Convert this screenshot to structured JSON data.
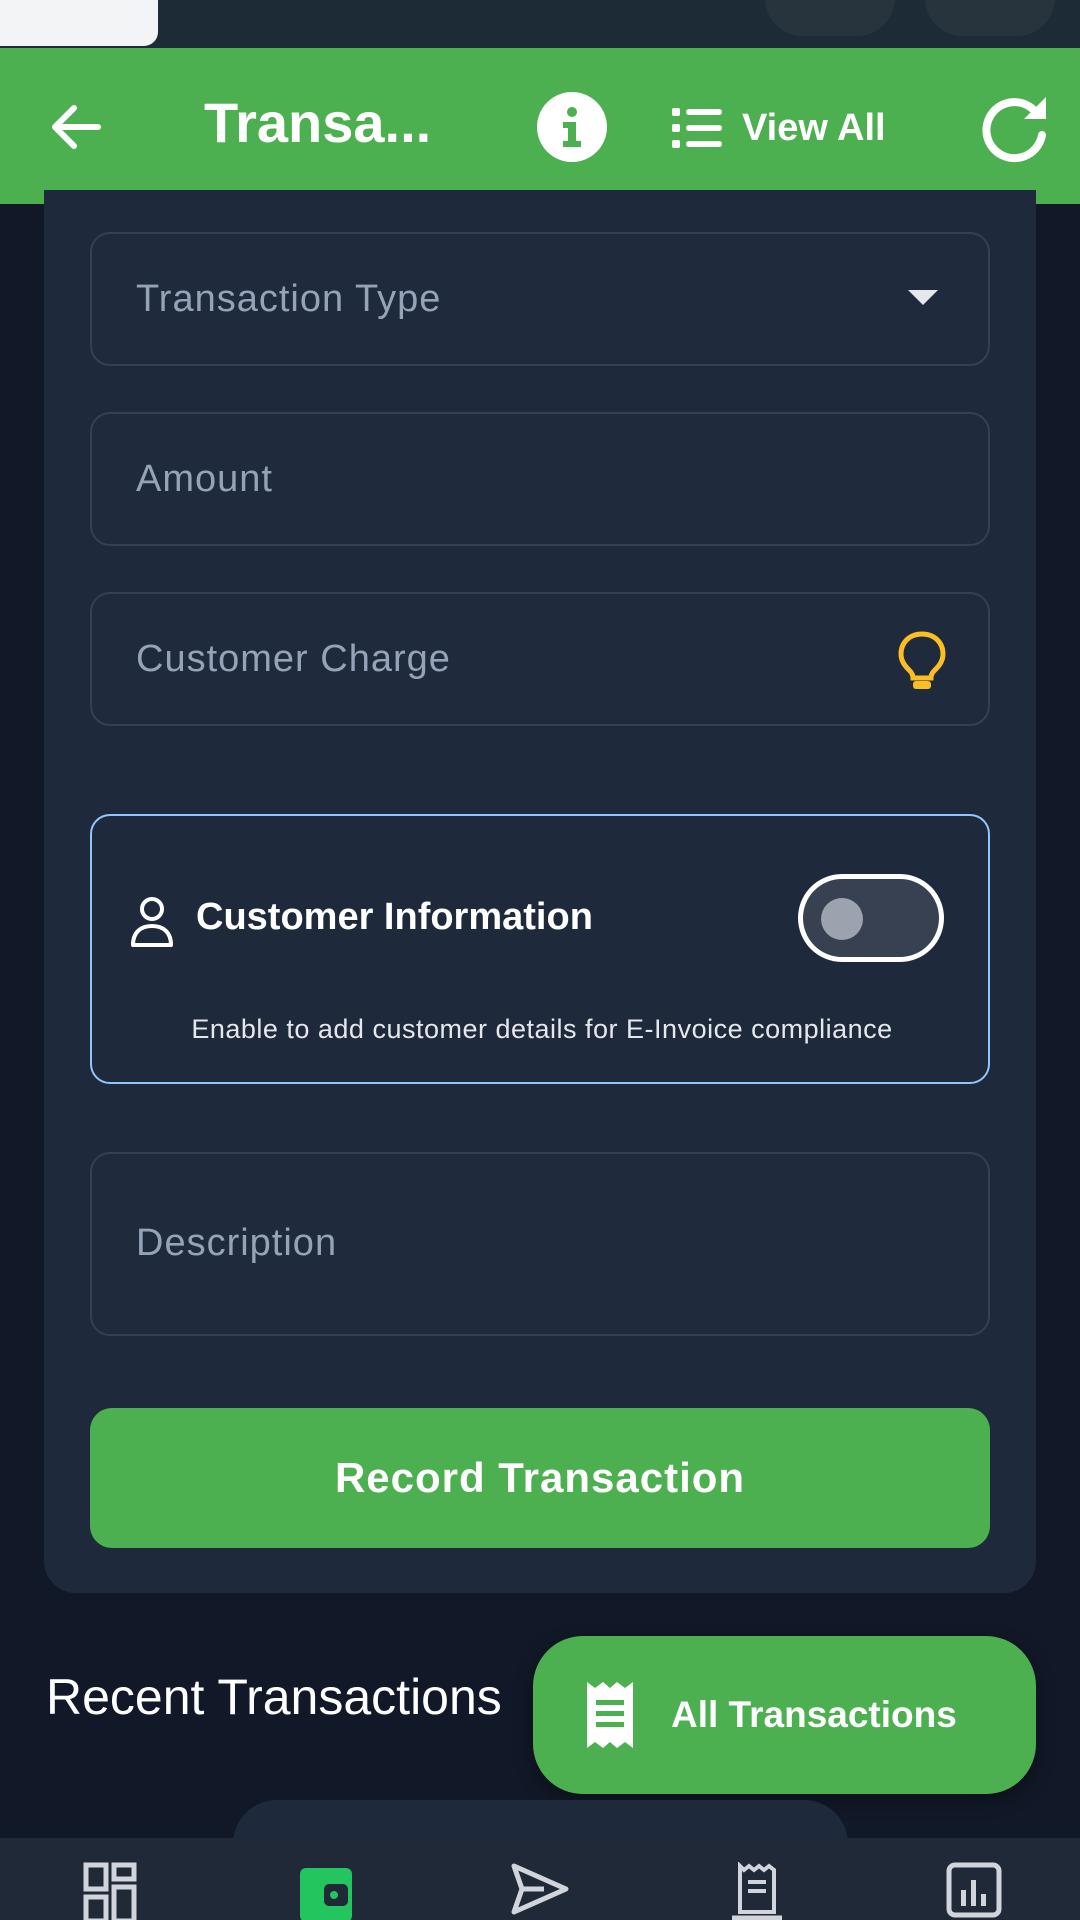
{
  "app_bar": {
    "title": "Transa...",
    "view_all_label": "View All",
    "icons": [
      "back-arrow-icon",
      "info-icon",
      "list-icon",
      "refresh-icon"
    ]
  },
  "form": {
    "transaction_type_placeholder": "Transaction Type",
    "amount_placeholder": "Amount",
    "customer_charge_placeholder": "Customer Charge",
    "customer_info": {
      "title": "Customer Information",
      "hint": "Enable to add customer details for E-Invoice compliance",
      "enabled": false
    },
    "description_placeholder": "Description",
    "submit_label": "Record Transaction"
  },
  "recent": {
    "title": "Recent Transactions"
  },
  "fab": {
    "label": "All Transactions",
    "icon": "receipt-icon"
  },
  "bottom_nav": {
    "items": [
      "dashboard-icon",
      "wallet-icon",
      "send-icon",
      "receipt-icon",
      "chart-icon"
    ],
    "active": "wallet-icon"
  },
  "colors": {
    "primary": "#4caf50",
    "background": "#111827",
    "card": "#1e293b",
    "accent_border": "#93c5fd",
    "bulb": "#fbbf24"
  }
}
